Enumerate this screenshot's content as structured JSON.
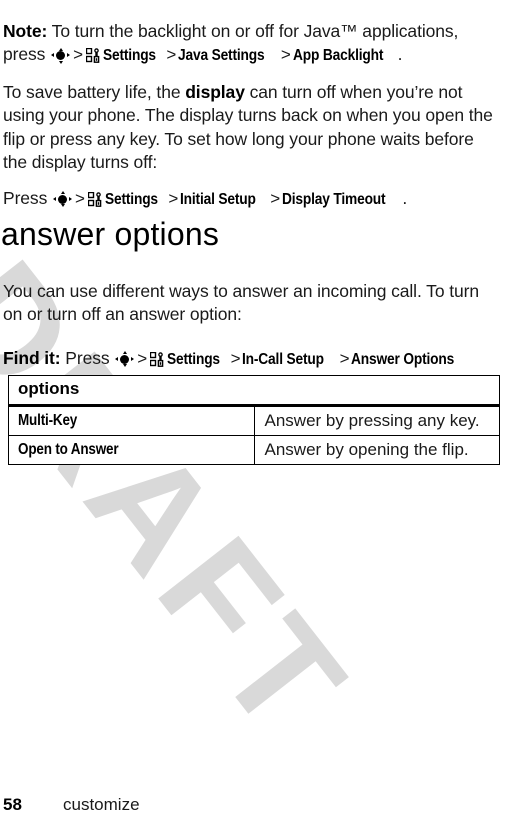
{
  "watermark": {
    "text": "DRAFT",
    "color": "#d9d9d9"
  },
  "note": {
    "label": "Note:",
    "text_before": " To turn the backlight on or off for Java™ applications, press ",
    "path": [
      "Settings",
      "Java Settings",
      "App Backlight"
    ],
    "trailing": "."
  },
  "battery_paragraph": {
    "part1": "To save battery life, the ",
    "emphasis": "display",
    "part2": " can turn off when you’re not using your phone. The display turns back on when you open the flip or press any key. To set how long your phone waits before the display turns off:"
  },
  "display_timeout_press": {
    "lead": "Press ",
    "path": [
      "Settings",
      "Initial Setup",
      "Display Timeout"
    ],
    "trailing": "."
  },
  "section": {
    "heading": "answer options",
    "intro": "You can use different ways to answer an incoming call. To turn on or turn off an answer option:",
    "find_it_label": "Find it:",
    "find_it_lead": " Press ",
    "find_it_path": [
      "Settings",
      "In-Call Setup",
      "Answer Options"
    ]
  },
  "options_table": {
    "header": "options",
    "rows": [
      {
        "name": "Multi-Key",
        "description": "Answer by pressing any key."
      },
      {
        "name": "Open to Answer",
        "description": "Answer by opening the flip."
      }
    ]
  },
  "separator": ">",
  "icons": {
    "center_key": "center-select-key-icon",
    "settings": "settings-menu-icon"
  },
  "footer": {
    "page_number": "58",
    "chapter": "customize"
  }
}
